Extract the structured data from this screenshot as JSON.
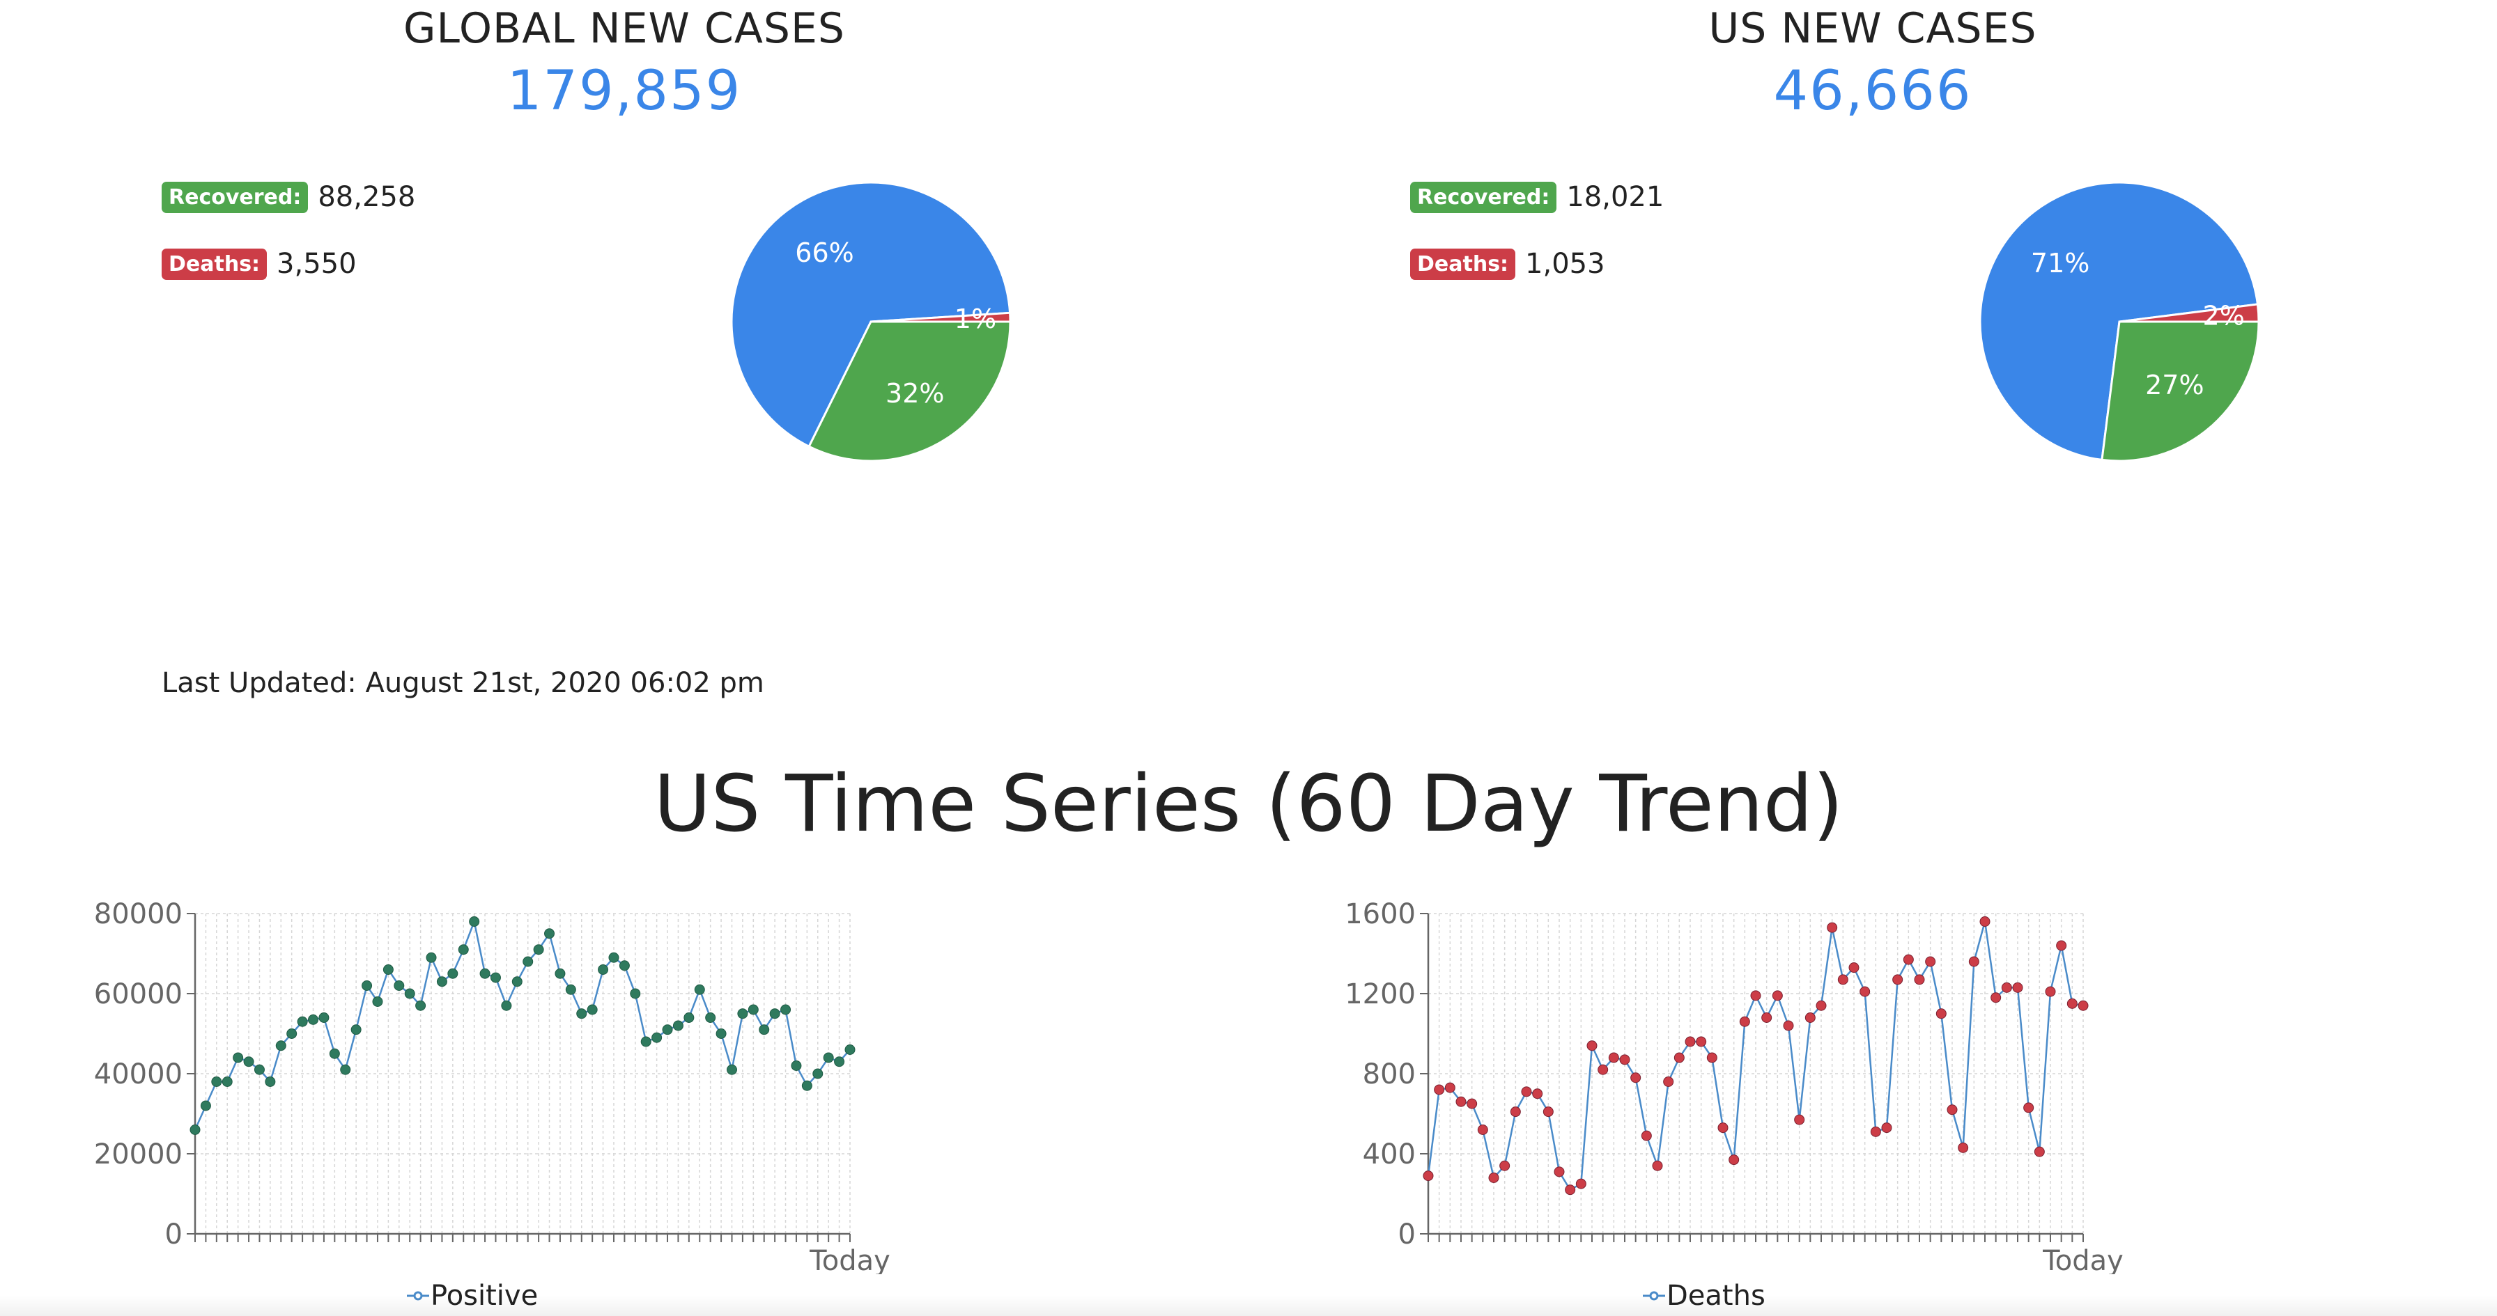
{
  "global": {
    "title": "GLOBAL NEW CASES",
    "number": "179,859",
    "recovered_label": "Recovered:",
    "recovered_value": "88,258",
    "deaths_label": "Deaths:",
    "deaths_value": "3,550",
    "pie": {
      "type": "pie",
      "slices": [
        {
          "label": "66%",
          "value": 66,
          "color": "#3a86e8"
        },
        {
          "label": "32%",
          "value": 32,
          "color": "#4fa64d"
        },
        {
          "label": "1%",
          "value": 1,
          "color": "#cc3d47"
        }
      ]
    }
  },
  "us": {
    "title": "US NEW CASES",
    "number": "46,666",
    "recovered_label": "Recovered:",
    "recovered_value": "18,021",
    "deaths_label": "Deaths:",
    "deaths_value": "1,053",
    "pie": {
      "type": "pie",
      "slices": [
        {
          "label": "71%",
          "value": 71,
          "color": "#3a86e8"
        },
        {
          "label": "27%",
          "value": 27,
          "color": "#4fa64d"
        },
        {
          "label": "2%",
          "value": 2,
          "color": "#cc3d47"
        }
      ]
    }
  },
  "last_updated": "Last Updated: August 21st, 2020 06:02 pm",
  "section_title": "US Time Series (60 Day Trend)",
  "chart_data": [
    {
      "type": "line",
      "series": [
        {
          "name": "Positive",
          "color": "#2f7a5e",
          "values": [
            26000,
            32000,
            38000,
            38000,
            44000,
            43000,
            41000,
            38000,
            47000,
            50000,
            53000,
            53500,
            54000,
            45000,
            41000,
            51000,
            62000,
            58000,
            66000,
            62000,
            60000,
            57000,
            69000,
            63000,
            65000,
            71000,
            78000,
            65000,
            64000,
            57000,
            63000,
            68000,
            71000,
            75000,
            65000,
            61000,
            55000,
            56000,
            66000,
            69000,
            67000,
            60000,
            48000,
            49000,
            51000,
            52000,
            54000,
            61000,
            54000,
            50000,
            41000,
            55000,
            56000,
            51000,
            55000,
            56000,
            42000,
            37000,
            40000,
            44000,
            43000,
            46000
          ]
        }
      ],
      "xlabel_last": "Today",
      "y_ticks": [
        "0",
        "20000",
        "40000",
        "60000",
        "80000"
      ],
      "ylim": [
        0,
        80000
      ],
      "grid": true,
      "legend": "bottom"
    },
    {
      "type": "line",
      "series": [
        {
          "name": "Deaths",
          "color": "#cc3d47",
          "line_color": "#4a8bc9",
          "values": [
            290,
            720,
            730,
            660,
            650,
            520,
            280,
            340,
            610,
            710,
            700,
            610,
            310,
            220,
            250,
            940,
            820,
            880,
            870,
            780,
            490,
            340,
            760,
            880,
            960,
            960,
            880,
            530,
            370,
            1060,
            1190,
            1080,
            1190,
            1040,
            570,
            1080,
            1140,
            1530,
            1270,
            1330,
            1210,
            510,
            530,
            1270,
            1370,
            1270,
            1360,
            1100,
            620,
            430,
            1360,
            1560,
            1180,
            1230,
            1230,
            630,
            410,
            1210,
            1440,
            1150,
            1140
          ]
        }
      ],
      "xlabel_last": "Today",
      "y_ticks": [
        "0",
        "400",
        "800",
        "1200",
        "1600"
      ],
      "ylim": [
        0,
        1600
      ],
      "grid": true,
      "legend": "bottom"
    }
  ]
}
